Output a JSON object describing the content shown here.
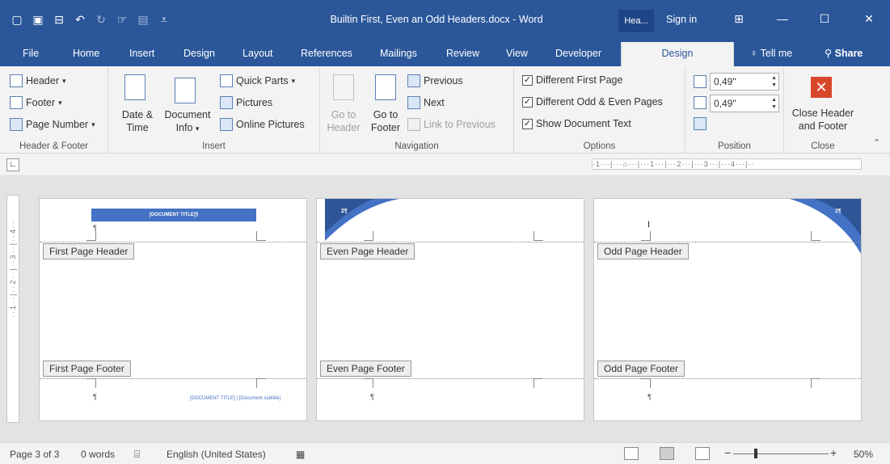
{
  "window": {
    "title": "Builtin First, Even an Odd Headers.docx  -  Word",
    "context_tab": "Hea...",
    "sign_in": "Sign in"
  },
  "tabs": [
    "File",
    "Home",
    "Insert",
    "Design",
    "Layout",
    "References",
    "Mailings",
    "Review",
    "View",
    "Developer"
  ],
  "active_tab": "Design",
  "tell_me": "Tell me",
  "share": "Share",
  "ribbon": {
    "header_footer": {
      "header": "Header",
      "footer": "Footer",
      "page_number": "Page Number",
      "label": "Header & Footer"
    },
    "insert": {
      "date_time_1": "Date &",
      "date_time_2": "Time",
      "document_info_1": "Document",
      "document_info_2": "Info",
      "quick_parts": "Quick Parts",
      "pictures": "Pictures",
      "online_pictures": "Online Pictures",
      "label": "Insert"
    },
    "navigation": {
      "goto_header_1": "Go to",
      "goto_header_2": "Header",
      "goto_footer_1": "Go to",
      "goto_footer_2": "Footer",
      "previous": "Previous",
      "next": "Next",
      "link_to_previous": "Link to Previous",
      "label": "Navigation"
    },
    "options": {
      "different_first_page": "Different First Page",
      "different_odd_even": "Different Odd & Even Pages",
      "show_document_text": "Show Document Text",
      "label": "Options"
    },
    "position": {
      "header_from_top": "0,49\"",
      "footer_from_bottom": "0,49\"",
      "label": "Position"
    },
    "close": {
      "close_1": "Close Header",
      "close_2": "and Footer",
      "label": "Close"
    }
  },
  "ruler": {
    "horizontal": "·1···|···⌂···|···1···|···2···|···3···|···4···|··",
    "vertical": "··1··|··2··|··3··|··4··"
  },
  "pages": [
    {
      "header_tag": "First Page Header",
      "footer_tag": "First Page Footer",
      "banner_text": "[DOCUMENT TITLE]¶",
      "footer_text": "[DOCUMENT TITLE] | [Document subtitle]"
    },
    {
      "header_tag": "Even Page Header",
      "footer_tag": "Even Page Footer",
      "page_number": "2¶"
    },
    {
      "header_tag": "Odd Page Header",
      "footer_tag": "Odd Page Footer",
      "page_number": "3¶"
    }
  ],
  "status": {
    "page": "Page 3 of 3",
    "words": "0 words",
    "language": "English (United States)",
    "zoom": "50%"
  },
  "colors": {
    "brand": "#2b579a",
    "accent": "#4472c4",
    "close_red": "#d9472b"
  }
}
